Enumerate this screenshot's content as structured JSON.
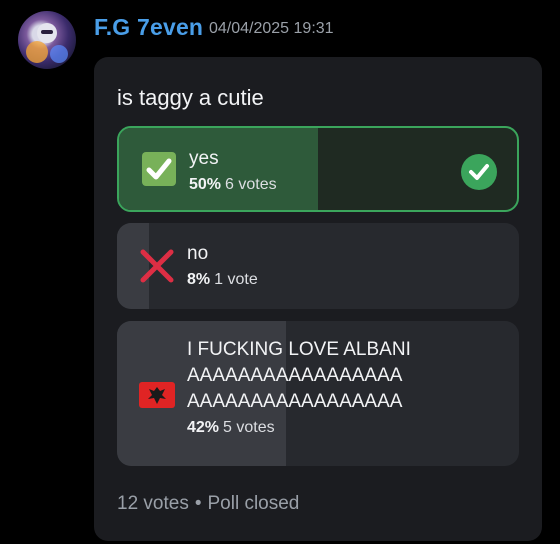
{
  "message": {
    "username": "F.G 7even",
    "timestamp": "04/04/2025 19:31",
    "username_color": "#4a9ee8"
  },
  "poll": {
    "question": "is taggy a cutie",
    "options": [
      {
        "label": "yes",
        "percent": "50%",
        "votes": "6 votes",
        "icon": "check-box-emoji",
        "fraction": 0.5,
        "selected": true
      },
      {
        "label": "no",
        "percent": "8%",
        "votes": "1 vote",
        "icon": "cross-mark-emoji",
        "fraction": 0.08,
        "selected": false
      },
      {
        "label_lines": [
          "I FUCKING LOVE ALBANI",
          "AAAAAAAAAAAAAAAAA",
          "AAAAAAAAAAAAAAAAA"
        ],
        "percent": "42%",
        "votes": "5 votes",
        "icon": "albania-flag-emoji",
        "fraction": 0.42,
        "selected": false
      }
    ],
    "total_votes": "12 votes",
    "separator": "•",
    "status": "Poll closed",
    "accent_green": "#3ba55c"
  }
}
